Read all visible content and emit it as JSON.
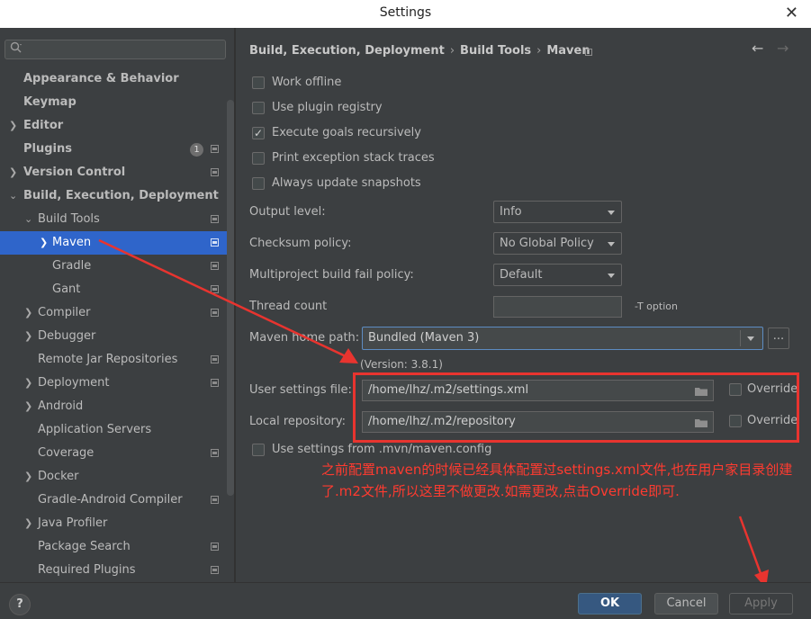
{
  "window": {
    "title": "Settings",
    "close_glyph": "✕"
  },
  "sidebar": {
    "search_glyph": "Q",
    "items": [
      {
        "label": "Appearance & Behavior"
      },
      {
        "label": "Keymap"
      },
      {
        "label": "Editor"
      },
      {
        "label": "Plugins",
        "badge": "1"
      },
      {
        "label": "Version Control"
      },
      {
        "label": "Build, Execution, Deployment"
      },
      {
        "label": "Build Tools"
      },
      {
        "label": "Maven"
      },
      {
        "label": "Gradle"
      },
      {
        "label": "Gant"
      },
      {
        "label": "Compiler"
      },
      {
        "label": "Debugger"
      },
      {
        "label": "Remote Jar Repositories"
      },
      {
        "label": "Deployment"
      },
      {
        "label": "Android"
      },
      {
        "label": "Application Servers"
      },
      {
        "label": "Coverage"
      },
      {
        "label": "Docker"
      },
      {
        "label": "Gradle-Android Compiler"
      },
      {
        "label": "Java Profiler"
      },
      {
        "label": "Package Search"
      },
      {
        "label": "Required Plugins"
      }
    ]
  },
  "breadcrumb": {
    "parts": [
      "Build, Execution, Deployment",
      "Build Tools",
      "Maven"
    ],
    "separator": "›",
    "back_glyph": "←",
    "forward_glyph": "→"
  },
  "options": {
    "work_offline": {
      "label": "Work offline",
      "checked": false
    },
    "use_plugin_registry": {
      "label": "Use plugin registry",
      "checked": false
    },
    "execute_goals": {
      "label": "Execute goals recursively",
      "checked": true
    },
    "print_exception": {
      "label": "Print exception stack traces",
      "checked": false
    },
    "always_update": {
      "label": "Always update snapshots",
      "checked": false
    }
  },
  "fields": {
    "output_level": {
      "label": "Output level:",
      "value": "Info"
    },
    "checksum_policy": {
      "label": "Checksum policy:",
      "value": "No Global Policy"
    },
    "fail_policy": {
      "label": "Multiproject build fail policy:",
      "value": "Default"
    },
    "thread_count": {
      "label": "Thread count",
      "value": "",
      "hint": "-T option"
    },
    "maven_home": {
      "label": "Maven home path:",
      "value": "Bundled (Maven 3)",
      "more": "...",
      "version": "(Version: 3.8.1)"
    },
    "user_settings": {
      "label": "User settings file:",
      "value": "/home/lhz/.m2/settings.xml",
      "override": "Override"
    },
    "local_repo": {
      "label": "Local repository:",
      "value": "/home/lhz/.m2/repository",
      "override": "Override"
    },
    "mvn_config": {
      "label": "Use settings from .mvn/maven.config",
      "checked": false
    }
  },
  "annotation": {
    "text": "之前配置maven的时候已经具体配置过settings.xml文件,也在用户家目录创建了.m2文件,所以这里不做更改.如需更改,点击Override即可.",
    "color": "#ff3b30"
  },
  "buttons": {
    "help": "?",
    "ok": "OK",
    "cancel": "Cancel",
    "apply": "Apply"
  },
  "colors": {
    "selection": "#2f65ca",
    "ok_button": "#365880",
    "annotation_red": "#e8342f"
  }
}
